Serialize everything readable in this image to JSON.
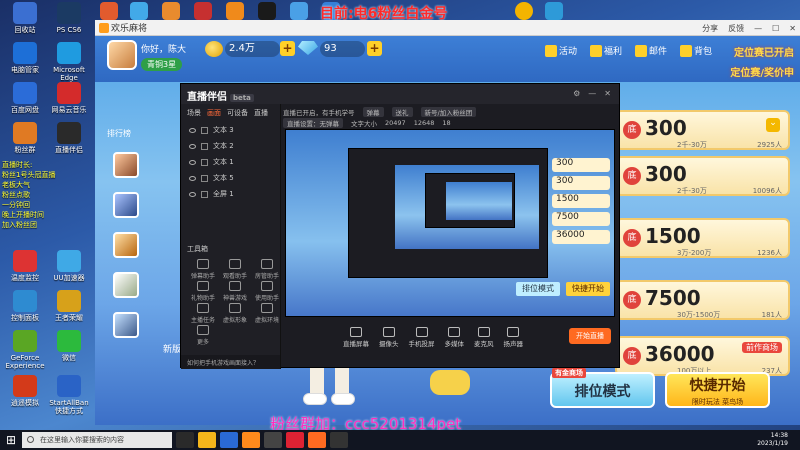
{
  "top_banner": "目前:电6粉丝白金号",
  "desktop_icons": [
    {
      "label": "回收站",
      "color": "#3b6fd1"
    },
    {
      "label": "PS CS6",
      "color": "#1b3a63"
    },
    {
      "label": "电脑管家",
      "color": "#1d6fd7"
    },
    {
      "label": "Microsoft Edge",
      "color": "#1f9be0"
    },
    {
      "label": "百度网盘",
      "color": "#2b6cd8"
    },
    {
      "label": "网易云音乐",
      "color": "#d42b2b"
    },
    {
      "label": "粉丝群",
      "color": "#e07a23"
    },
    {
      "label": "直播伴侣",
      "color": "#2a2a2a"
    },
    {
      "label": "温度监控",
      "color": "#d33"
    },
    {
      "label": "UU加速器",
      "color": "#3fa9e6"
    },
    {
      "label": "控制面板",
      "color": "#2e8bd1"
    },
    {
      "label": "王者荣耀",
      "color": "#d7a11a"
    },
    {
      "label": "GeForce Experience",
      "color": "#5aa624"
    },
    {
      "label": "微信",
      "color": "#2cba3d"
    },
    {
      "label": "逍遥模拟",
      "color": "#d33a1a"
    },
    {
      "label": "StartAllBan 快捷方式",
      "color": "#2a63c6"
    }
  ],
  "desktop_notes": [
    "直播时长:",
    "粉丝1号头冠直播",
    "老板大气",
    "粉丝点歌",
    "一分钟回",
    "晚上开播时间",
    "加入粉丝团"
  ],
  "game": {
    "window_title": "欢乐麻将",
    "titlebar_actions": [
      "分享",
      "反馈"
    ],
    "player_name": "你好，陈大",
    "player_rank": "青铜3星",
    "gold": "2.4万",
    "gems": "93",
    "nav": [
      {
        "label": "活动",
        "icon": "gift-icon"
      },
      {
        "label": "福利",
        "icon": "bonus-icon"
      },
      {
        "label": "邮件",
        "icon": "mail-icon"
      },
      {
        "label": "背包",
        "icon": "bag-icon"
      }
    ],
    "promo": "定位赛已开启",
    "promo_sub": "定位赛/奖价申",
    "ranking_label": "排行榜",
    "rooms": [
      {
        "value": "300",
        "range": "2千-30万",
        "count": "2925人",
        "tag": ""
      },
      {
        "value": "300",
        "range": "2千-30万",
        "count": "10096人",
        "tag": ""
      },
      {
        "value": "1500",
        "range": "3万-200万",
        "count": "1236人",
        "tag": ""
      },
      {
        "value": "7500",
        "range": "30万-1500万",
        "count": "181人",
        "tag": ""
      },
      {
        "value": "36000",
        "range": "100万以上",
        "count": "237人",
        "tag": "前作商场"
      }
    ],
    "rank_mode": "排位模式",
    "rank_mode_tag": "有金商场",
    "quick_start": "快捷开始",
    "quick_start_sub": "限时玩法 菜鸟场",
    "subscriber_tag": "新版"
  },
  "obs": {
    "app_name": "直播伴侣",
    "version": "beta",
    "side_tabs": [
      "场景",
      "画面",
      "可设备",
      "直播"
    ],
    "layers": [
      "文本 3",
      "文本 2",
      "文本 1",
      "文本 5",
      "全屏 1"
    ],
    "tools_title": "工具箱",
    "tools": [
      "弹幕助手",
      "观看助手",
      "房管助手",
      "礼物助手",
      "神兽游戏",
      "使用助手",
      "主播任务",
      "虚拟形象",
      "虚拟环境",
      "更多"
    ],
    "cam_hint": "如何把手机游戏画面接入？",
    "toolbar_row1": [
      "直播已开启，有手机学号",
      "弹幕",
      "送礼",
      "新号/加入粉丝团"
    ],
    "toolbar_row2": [
      "直播设置：无弹幕",
      "文字大小",
      "弹幕模式"
    ],
    "toolbar_stats": [
      "20497",
      "12648",
      "18"
    ],
    "bottom": [
      "直播屏幕",
      "摄像头",
      "手机投屏",
      "多媒体",
      "麦克风",
      "扬声器"
    ],
    "go_live": "开始直播"
  },
  "fans_line": "粉丝群加：ccc5201314pet",
  "taskbar": {
    "search_placeholder": "在这里输入你要搜索的内容",
    "time": "14:38",
    "date": "2023/1/19"
  }
}
